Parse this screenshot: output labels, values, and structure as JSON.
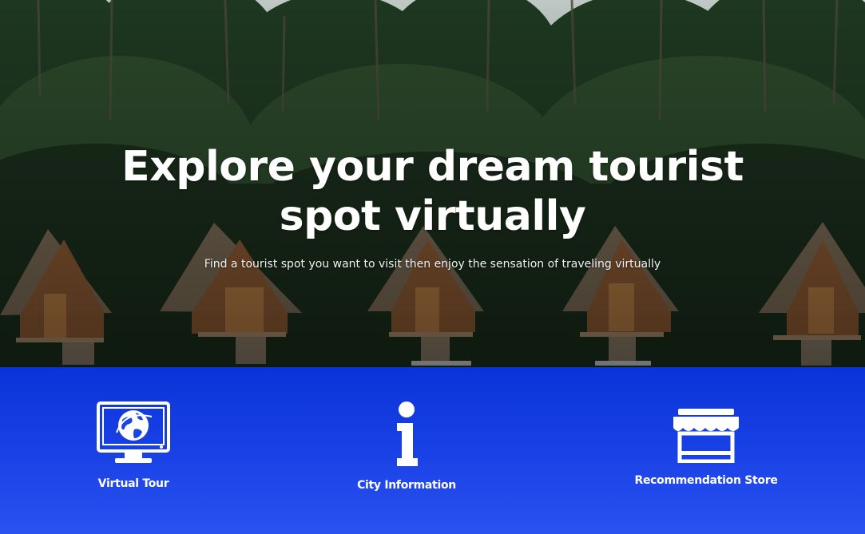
{
  "hero": {
    "title_line1": "Explore your dream tourist",
    "title_line2": "spot virtually",
    "subtitle": "Find a tourist spot you want to visit then enjoy the sensation of traveling virtually",
    "background": "forest-huts-photo"
  },
  "features": [
    {
      "label": "Virtual Tour",
      "icon": "monitor-globe-icon"
    },
    {
      "label": "City Information",
      "icon": "info-icon"
    },
    {
      "label": "Recommendation Store",
      "icon": "storefront-icon"
    }
  ],
  "colors": {
    "accent_blue": "#1a42e6",
    "text_white": "#ffffff"
  }
}
